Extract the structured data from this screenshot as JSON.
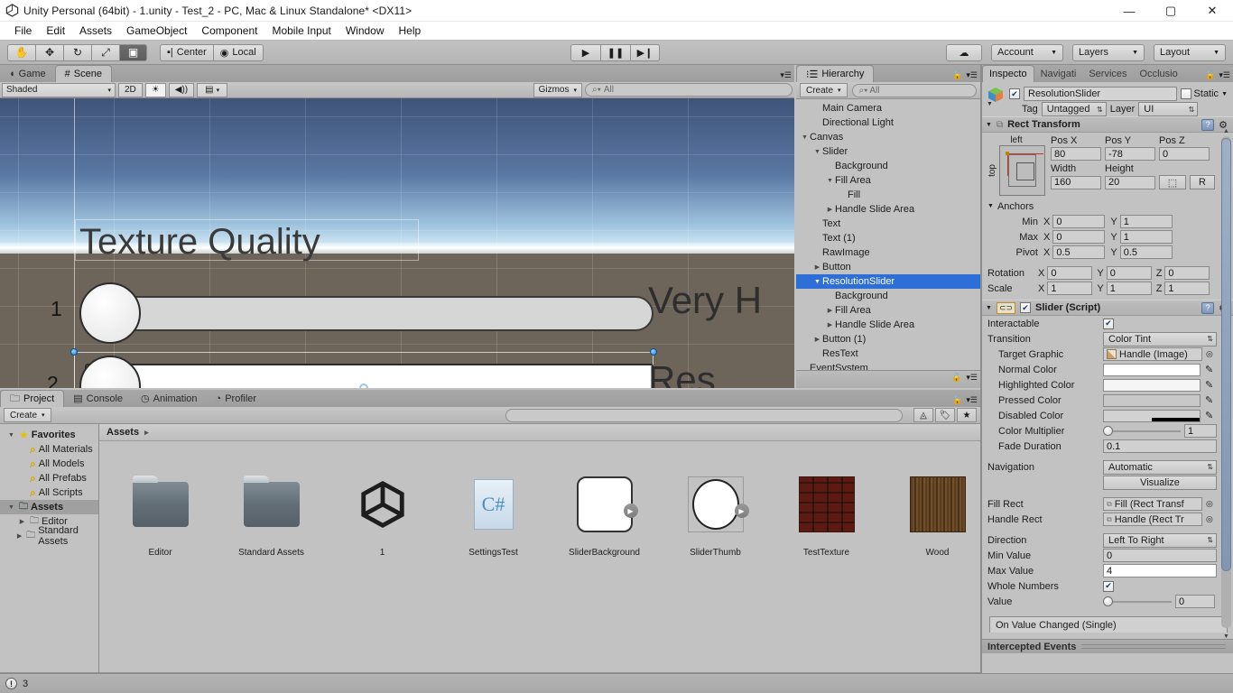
{
  "window": {
    "title": "Unity Personal (64bit) - 1.unity - Test_2 - PC, Mac & Linux Standalone* <DX11>",
    "minimize": "—",
    "maximize": "▢",
    "close": "✕"
  },
  "menu": [
    "File",
    "Edit",
    "Assets",
    "GameObject",
    "Component",
    "Mobile Input",
    "Window",
    "Help"
  ],
  "toolbar": {
    "tools": [
      "✋",
      "✥",
      "↻",
      "⤢",
      "▣"
    ],
    "active_tool_index": 4,
    "pivot_label": "Center",
    "space_label": "Local",
    "play": "▶",
    "pause": "❚❚",
    "step": "▶❙",
    "cloud": "☁",
    "account": "Account",
    "layers": "Layers",
    "layout": "Layout"
  },
  "scene": {
    "tabs": [
      {
        "label": "Game",
        "icon": "gamepad-icon",
        "active": false
      },
      {
        "label": "Scene",
        "icon": "hash-icon",
        "active": true
      }
    ],
    "shading": "Shaded",
    "mode_2d": "2D",
    "light_icon": "☀",
    "audio_icon": "◀))",
    "fx_icon": "▤",
    "gizmos": "Gizmos",
    "search_placeholder": "All",
    "canvas": {
      "title_text": "Texture Quality",
      "label_very": "Very H",
      "label_res": "Res",
      "marker_1": "1",
      "marker_2": "2"
    }
  },
  "hierarchy": {
    "tab_label": "Hierarchy",
    "create_label": "Create",
    "search_placeholder": "All",
    "items": [
      {
        "label": "Main Camera",
        "depth": 1,
        "twist": "",
        "selected": false
      },
      {
        "label": "Directional Light",
        "depth": 1,
        "twist": "",
        "selected": false
      },
      {
        "label": "Canvas",
        "depth": 0,
        "twist": "▼",
        "selected": false
      },
      {
        "label": "Slider",
        "depth": 1,
        "twist": "▼",
        "selected": false
      },
      {
        "label": "Background",
        "depth": 2,
        "twist": "",
        "selected": false
      },
      {
        "label": "Fill Area",
        "depth": 2,
        "twist": "▼",
        "selected": false
      },
      {
        "label": "Fill",
        "depth": 3,
        "twist": "",
        "selected": false
      },
      {
        "label": "Handle Slide Area",
        "depth": 2,
        "twist": "▶",
        "selected": false
      },
      {
        "label": "Text",
        "depth": 1,
        "twist": "",
        "selected": false
      },
      {
        "label": "Text (1)",
        "depth": 1,
        "twist": "",
        "selected": false
      },
      {
        "label": "RawImage",
        "depth": 1,
        "twist": "",
        "selected": false
      },
      {
        "label": "Button",
        "depth": 1,
        "twist": "▶",
        "selected": false
      },
      {
        "label": "ResolutionSlider",
        "depth": 1,
        "twist": "▼",
        "selected": true
      },
      {
        "label": "Background",
        "depth": 2,
        "twist": "",
        "selected": false
      },
      {
        "label": "Fill Area",
        "depth": 2,
        "twist": "▶",
        "selected": false
      },
      {
        "label": "Handle Slide Area",
        "depth": 2,
        "twist": "▶",
        "selected": false
      },
      {
        "label": "Button (1)",
        "depth": 1,
        "twist": "▶",
        "selected": false
      },
      {
        "label": "ResText",
        "depth": 1,
        "twist": "",
        "selected": false
      },
      {
        "label": "EventSystem",
        "depth": 0,
        "twist": "",
        "selected": false
      }
    ]
  },
  "project": {
    "tabs": [
      {
        "label": "Project",
        "icon": "folder-icon",
        "active": true
      },
      {
        "label": "Console",
        "icon": "console-icon",
        "active": false
      },
      {
        "label": "Animation",
        "icon": "clock-icon",
        "active": false
      },
      {
        "label": "Profiler",
        "icon": "profiler-icon",
        "active": false
      }
    ],
    "create_label": "Create",
    "search_placeholder": "",
    "tree": [
      {
        "label": "Favorites",
        "depth": 0,
        "twist": "▼",
        "icon": "star-icon",
        "sel": false,
        "bold": true
      },
      {
        "label": "All Materials",
        "depth": 1,
        "twist": "",
        "icon": "search-icon",
        "sel": false,
        "bold": false
      },
      {
        "label": "All Models",
        "depth": 1,
        "twist": "",
        "icon": "search-icon",
        "sel": false,
        "bold": false
      },
      {
        "label": "All Prefabs",
        "depth": 1,
        "twist": "",
        "icon": "search-icon",
        "sel": false,
        "bold": false
      },
      {
        "label": "All Scripts",
        "depth": 1,
        "twist": "",
        "icon": "search-icon",
        "sel": false,
        "bold": false
      },
      {
        "label": "Assets",
        "depth": 0,
        "twist": "▼",
        "icon": "folder-icon",
        "sel": true,
        "bold": true
      },
      {
        "label": "Editor",
        "depth": 1,
        "twist": "▶",
        "icon": "folder-icon",
        "sel": false,
        "bold": false
      },
      {
        "label": "Standard Assets",
        "depth": 1,
        "twist": "▶",
        "icon": "folder-icon",
        "sel": false,
        "bold": false
      }
    ],
    "breadcrumb": "Assets",
    "breadcrumb_arrow": "▸",
    "assets": [
      {
        "name": "Editor",
        "kind": "folder"
      },
      {
        "name": "Standard Assets",
        "kind": "folder"
      },
      {
        "name": "1",
        "kind": "unity-scene"
      },
      {
        "name": "SettingsTest",
        "kind": "csharp"
      },
      {
        "name": "SliderBackground",
        "kind": "sprite-rounded"
      },
      {
        "name": "SliderThumb",
        "kind": "sprite-circle"
      },
      {
        "name": "TestTexture",
        "kind": "texture-brick"
      },
      {
        "name": "Wood",
        "kind": "texture-wood"
      }
    ]
  },
  "inspector": {
    "tabs": [
      {
        "label": "Inspecto",
        "active": true
      },
      {
        "label": "Navigati",
        "active": false
      },
      {
        "label": "Services",
        "active": false
      },
      {
        "label": "Occlusio",
        "active": false
      }
    ],
    "object_name": "ResolutionSlider",
    "enabled": true,
    "static_label": "Static",
    "static_checked": false,
    "tag_label": "Tag",
    "tag_value": "Untagged",
    "layer_label": "Layer",
    "layer_value": "UI",
    "rect_transform": {
      "title": "Rect Transform",
      "anchor_preset_top": "left",
      "anchor_preset_side": "top",
      "labels": {
        "posx": "Pos X",
        "posy": "Pos Y",
        "posz": "Pos Z",
        "width": "Width",
        "height": "Height"
      },
      "pos_x": "80",
      "pos_y": "-78",
      "pos_z": "0",
      "width": "160",
      "height": "20",
      "blueprint_btn": "⬚",
      "raw_btn": "R",
      "anchors_label": "Anchors",
      "min_label": "Min",
      "min_x": "0",
      "min_y": "1",
      "max_label": "Max",
      "max_x": "0",
      "max_y": "1",
      "pivot_label": "Pivot",
      "pivot_x": "0.5",
      "pivot_y": "0.5",
      "rotation_label": "Rotation",
      "rot_x": "0",
      "rot_y": "0",
      "rot_z": "0",
      "scale_label": "Scale",
      "scale_x": "1",
      "scale_y": "1",
      "scale_z": "1",
      "x_tag": "X",
      "y_tag": "Y",
      "z_tag": "Z"
    },
    "slider_script": {
      "title": "Slider (Script)",
      "enabled": true,
      "interactable_label": "Interactable",
      "interactable": true,
      "transition_label": "Transition",
      "transition_value": "Color Tint",
      "target_graphic_label": "Target Graphic",
      "target_graphic_value": "Handle (Image)",
      "normal_color_label": "Normal Color",
      "normal_color": "#ffffff",
      "highlighted_color_label": "Highlighted Color",
      "highlighted_color": "#f5f5f5",
      "pressed_color_label": "Pressed Color",
      "pressed_color": "#c8c8c8",
      "disabled_color_label": "Disabled Color",
      "disabled_color": "#d2d2d2",
      "color_multiplier_label": "Color Multiplier",
      "color_multiplier": "1",
      "fade_duration_label": "Fade Duration",
      "fade_duration": "0.1",
      "navigation_label": "Navigation",
      "navigation_value": "Automatic",
      "visualize_label": "Visualize",
      "fill_rect_label": "Fill Rect",
      "fill_rect_value": "Fill (Rect Transf",
      "handle_rect_label": "Handle Rect",
      "handle_rect_value": "Handle (Rect Tr",
      "direction_label": "Direction",
      "direction_value": "Left To Right",
      "min_value_label": "Min Value",
      "min_value": "0",
      "max_value_label": "Max Value",
      "max_value": "4",
      "whole_numbers_label": "Whole Numbers",
      "whole_numbers": true,
      "value_label": "Value",
      "value": "0",
      "on_value_changed": "On Value Changed (Single)"
    },
    "intercepted_events": "Intercepted Events"
  },
  "status": {
    "count": "3",
    "icon": "warning-icon"
  }
}
